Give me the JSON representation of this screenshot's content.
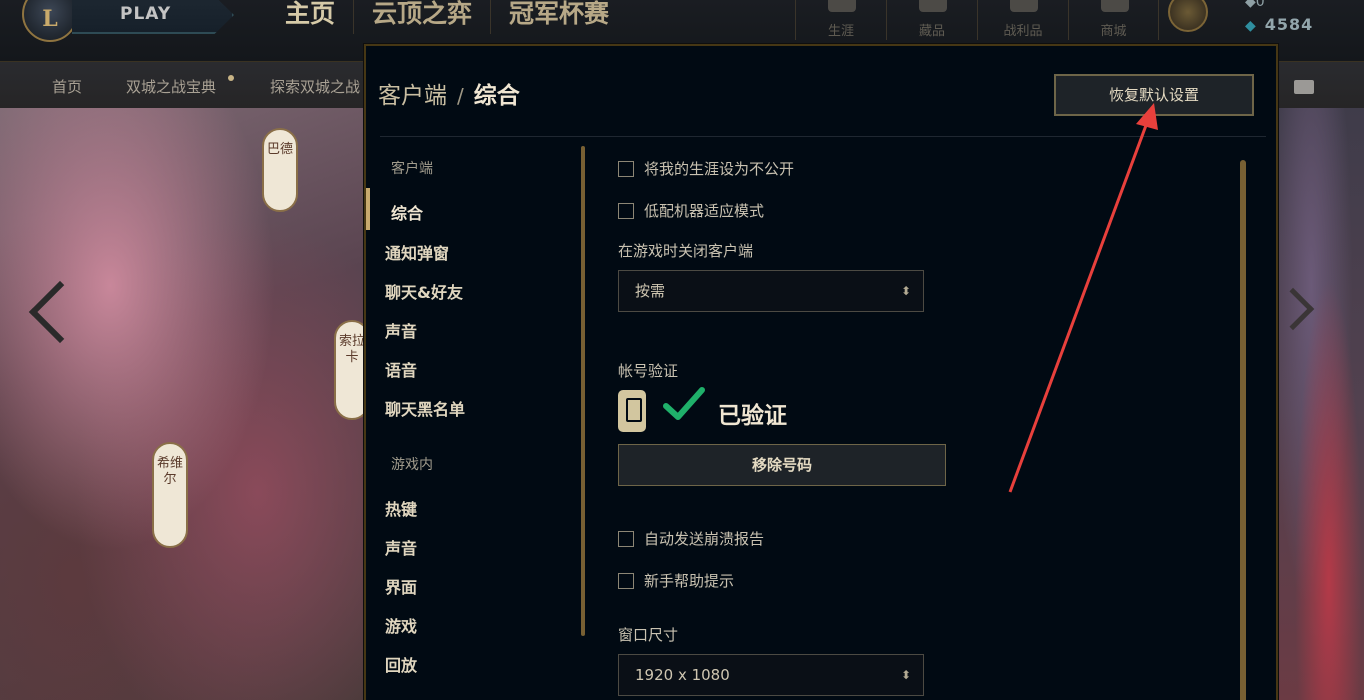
{
  "app": {
    "logo_letter": "L",
    "play_label": "PLAY"
  },
  "top_nav": {
    "tabs": [
      "主页",
      "云顶之弈",
      "冠军杯赛"
    ],
    "icons": [
      {
        "label": "生涯",
        "icon": "career-icon"
      },
      {
        "label": "藏品",
        "icon": "collection-icon"
      },
      {
        "label": "战利品",
        "icon": "loot-icon"
      },
      {
        "label": "商城",
        "icon": "store-icon"
      }
    ],
    "currency_top": "0",
    "currency_value": "4584",
    "currency_icon": "blue-essence-icon"
  },
  "sub_nav": {
    "items": [
      "首页",
      "双城之战宝典",
      "探索双城之战"
    ]
  },
  "background": {
    "scroll_tags": [
      "巴德",
      "索拉卡",
      "希维尔"
    ]
  },
  "settings": {
    "breadcrumb_parent": "客户端",
    "breadcrumb_sep": "/",
    "breadcrumb_current": "综合",
    "restore_defaults_label": "恢复默认设置",
    "sidebar": {
      "section_client": "客户端",
      "client_items": [
        "综合",
        "通知弹窗",
        "聊天&好友",
        "声音",
        "语音",
        "聊天黑名单"
      ],
      "section_ingame": "游戏内",
      "ingame_items": [
        "热键",
        "声音",
        "界面",
        "游戏",
        "回放"
      ]
    },
    "checkboxes": {
      "private_career": "将我的生涯设为不公开",
      "low_spec": "低配机器适应模式",
      "auto_crash_report": "自动发送崩溃报告",
      "newbie_tips": "新手帮助提示"
    },
    "close_client_label": "在游戏时关闭客户端",
    "close_client_value": "按需",
    "account_verify_label": "帐号验证",
    "verified_text": "已验证",
    "remove_number_label": "移除号码",
    "window_size_label": "窗口尺寸",
    "window_size_value": "1920 x 1080"
  },
  "colors": {
    "gold_border": "#463714",
    "modal_bg": "#010a13",
    "accent_gold": "#c8aa6e",
    "check_green": "#1fb06a",
    "annotation_red": "#e8403c"
  }
}
